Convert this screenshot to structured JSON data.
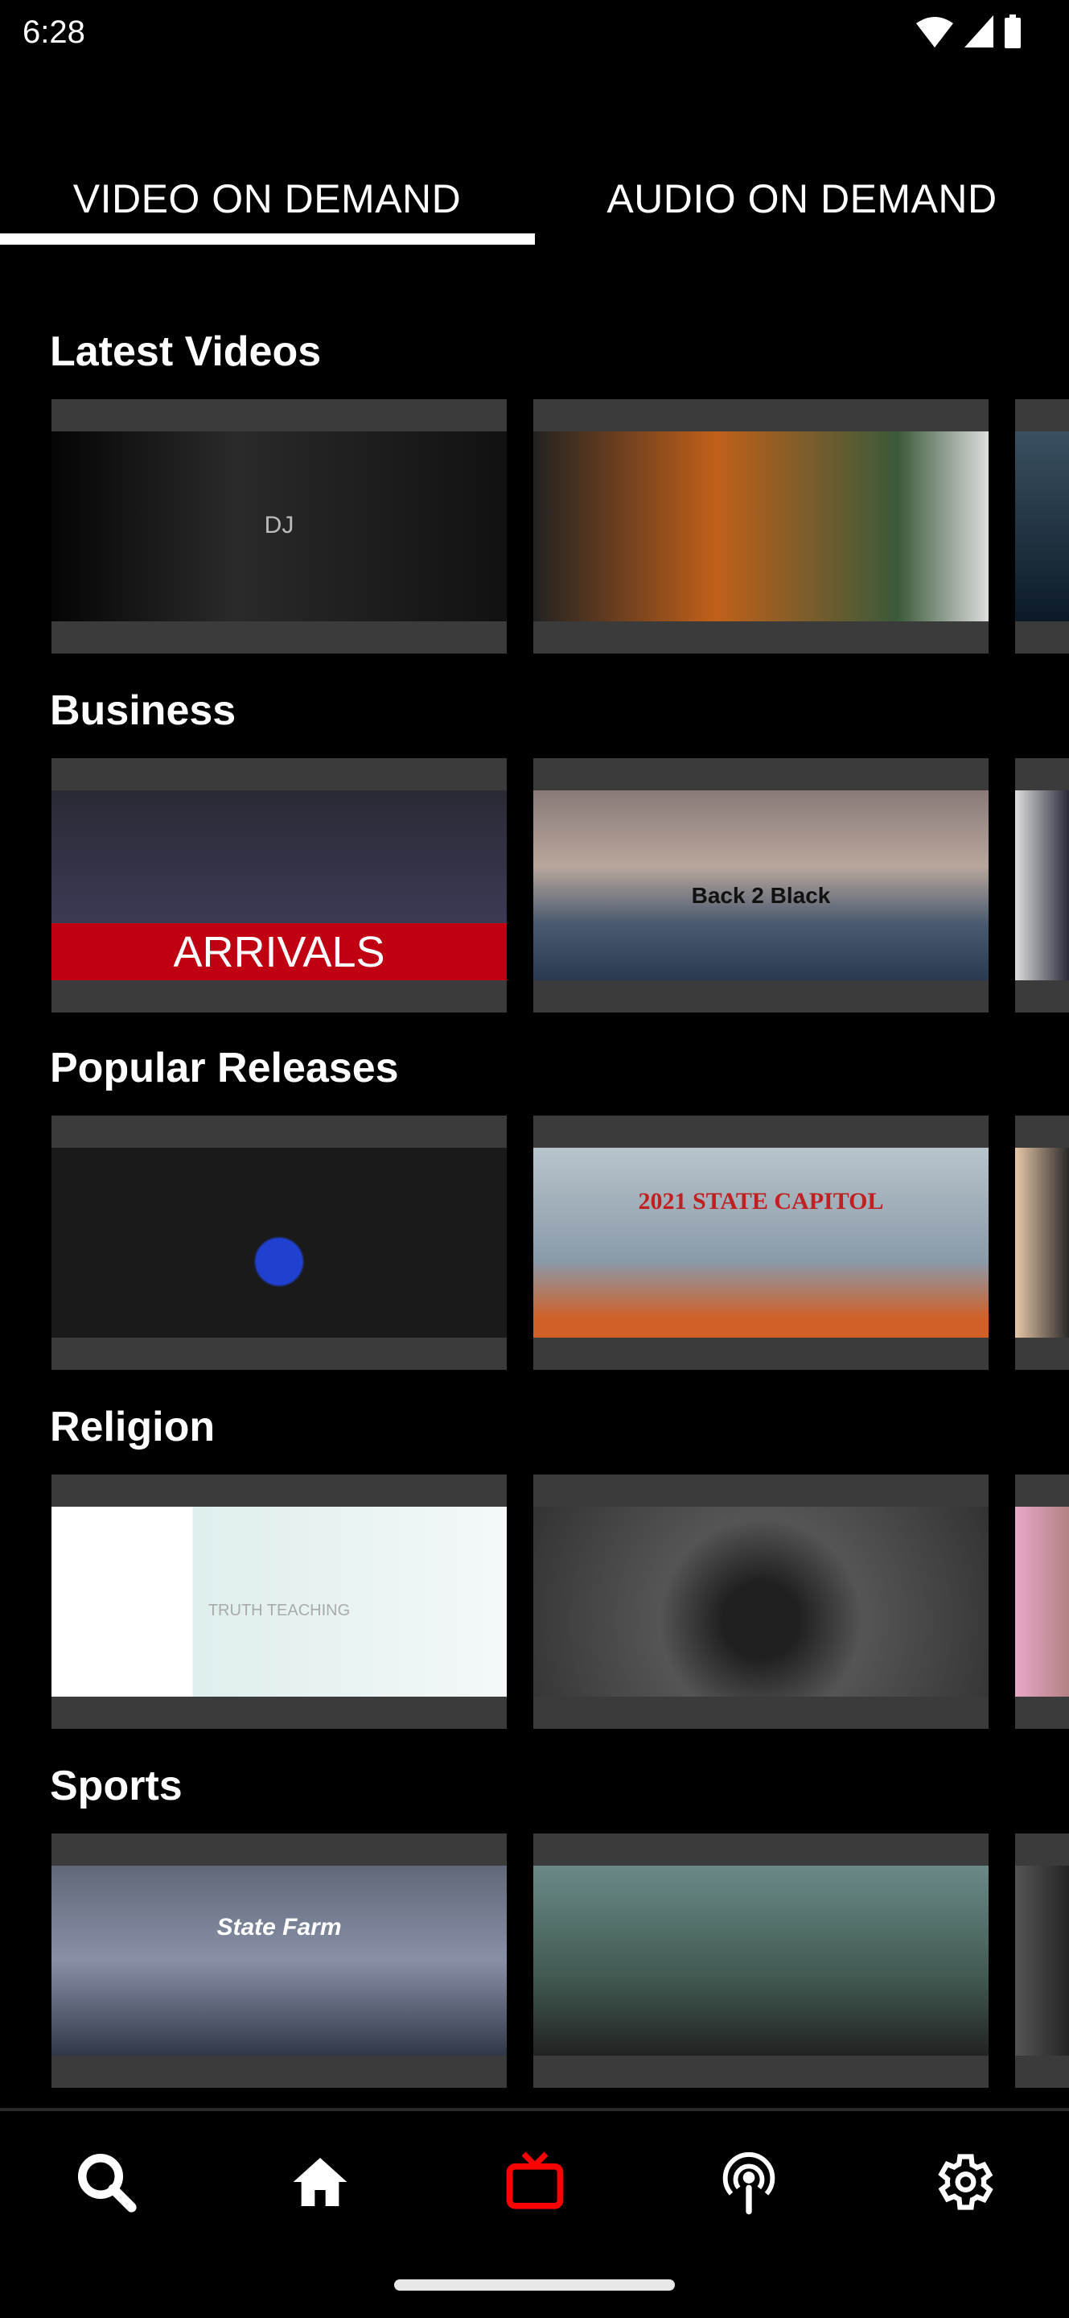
{
  "status_bar": {
    "time": "6:28",
    "icons": [
      "wifi-icon",
      "signal-icon",
      "battery-icon"
    ]
  },
  "tabs": [
    {
      "label": "VIDEO ON DEMAND",
      "active": true
    },
    {
      "label": "AUDIO ON DEMAND",
      "active": false
    }
  ],
  "sections": [
    {
      "title": "Latest Videos",
      "cards": [
        {
          "caption": "DJ"
        },
        {
          "caption": ""
        },
        {
          "caption": ""
        }
      ]
    },
    {
      "title": "Business",
      "cards": [
        {
          "caption": "ARRIVALS"
        },
        {
          "caption": "Back 2 Black"
        },
        {
          "caption": ""
        }
      ]
    },
    {
      "title": "Popular Releases",
      "cards": [
        {
          "caption": ""
        },
        {
          "caption": "2021 STATE CAPITOL"
        },
        {
          "caption": ""
        }
      ]
    },
    {
      "title": "Religion",
      "cards": [
        {
          "caption": "TRUTH TEACHING"
        },
        {
          "caption": ""
        },
        {
          "caption": ""
        }
      ]
    },
    {
      "title": "Sports",
      "cards": [
        {
          "caption": "State Farm"
        },
        {
          "caption": ""
        },
        {
          "caption": ""
        }
      ]
    }
  ],
  "bottom_nav": [
    {
      "icon": "search-icon",
      "active": false
    },
    {
      "icon": "home-icon",
      "active": false
    },
    {
      "icon": "tv-icon",
      "active": true
    },
    {
      "icon": "podcast-icon",
      "active": false
    },
    {
      "icon": "settings-icon",
      "active": false
    }
  ],
  "colors": {
    "accent": "#ff0000",
    "background": "#000000",
    "card": "#3b3b3b"
  }
}
